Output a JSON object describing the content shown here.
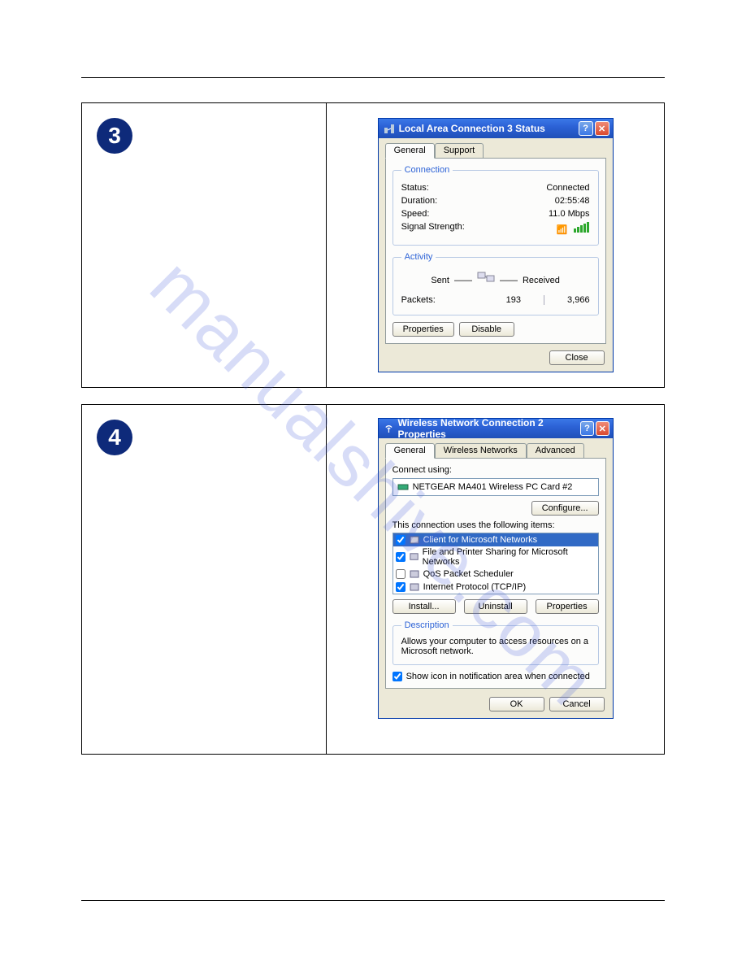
{
  "watermark": "manualshive.com",
  "steps": [
    3,
    4
  ],
  "dialog1": {
    "title": "Local Area Connection 3 Status",
    "tabs": [
      "General",
      "Support"
    ],
    "group_connection": "Connection",
    "status_label": "Status:",
    "status_value": "Connected",
    "duration_label": "Duration:",
    "duration_value": "02:55:48",
    "speed_label": "Speed:",
    "speed_value": "11.0 Mbps",
    "signal_label": "Signal Strength:",
    "group_activity": "Activity",
    "sent_label": "Sent",
    "received_label": "Received",
    "packets_label": "Packets:",
    "packets_sent": "193",
    "packets_received": "3,966",
    "btn_properties": "Properties",
    "btn_disable": "Disable",
    "btn_close": "Close"
  },
  "dialog2": {
    "title": "Wireless Network Connection 2 Properties",
    "tabs": [
      "General",
      "Wireless Networks",
      "Advanced"
    ],
    "connect_using_label": "Connect using:",
    "adapter": "NETGEAR MA401 Wireless PC Card #2",
    "btn_configure": "Configure...",
    "items_label": "This connection uses the following items:",
    "items": [
      {
        "checked": true,
        "label": "Client for Microsoft Networks",
        "selected": true
      },
      {
        "checked": true,
        "label": "File and Printer Sharing for Microsoft Networks",
        "selected": false
      },
      {
        "checked": false,
        "label": "QoS Packet Scheduler",
        "selected": false
      },
      {
        "checked": true,
        "label": "Internet Protocol (TCP/IP)",
        "selected": false
      }
    ],
    "btn_install": "Install...",
    "btn_uninstall": "Uninstall",
    "btn_properties": "Properties",
    "group_description": "Description",
    "description_text": "Allows your computer to access resources on a Microsoft network.",
    "show_icon_label": "Show icon in notification area when connected",
    "btn_ok": "OK",
    "btn_cancel": "Cancel"
  }
}
